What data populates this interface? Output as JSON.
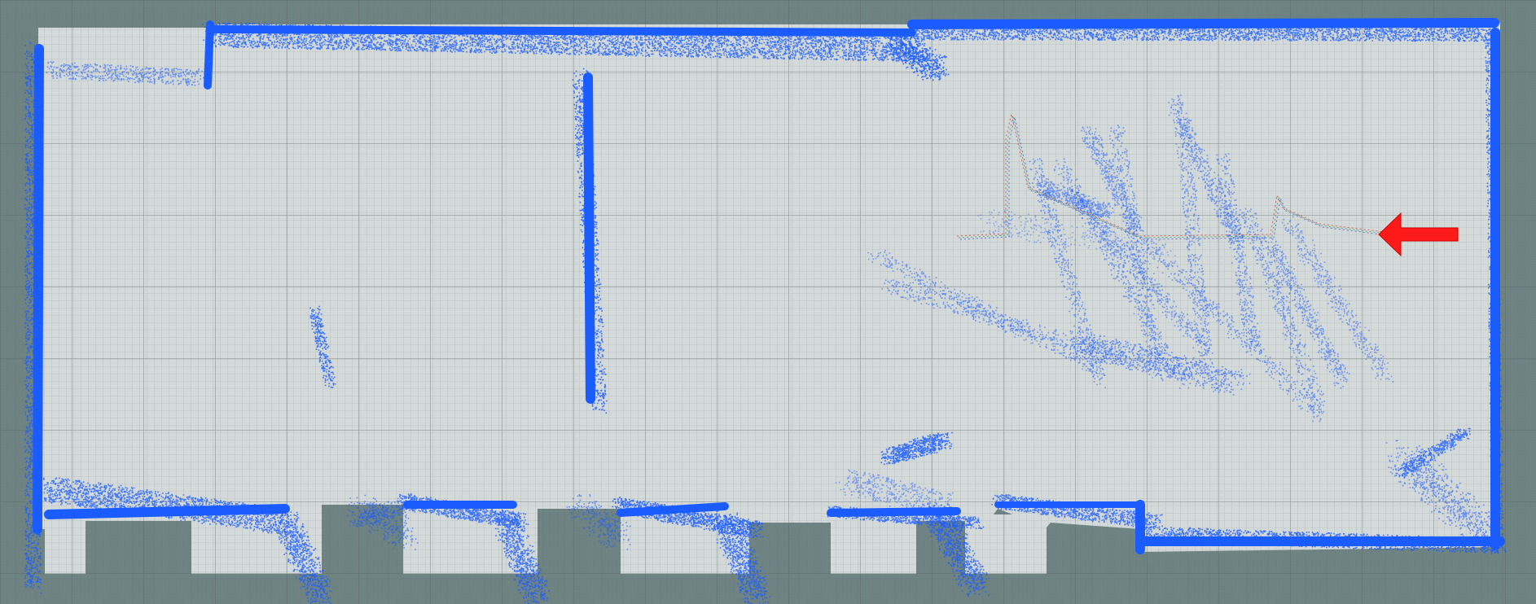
{
  "view": {
    "type": "occupancy-grid-map",
    "background_color": "#6f8482",
    "grid_color": "#5b6b6a",
    "map_free_color": "#d4d9d9",
    "map_grid_color": "#9aa3a3",
    "laser_scan_color": "#1a5cff",
    "pose_arrow_color": "#ff1a1a",
    "planned_path_colors": [
      "#d94040",
      "#3ea04a",
      "#3b5bd9"
    ],
    "grid": true
  },
  "robot": {
    "heading": "left",
    "icon": "pose-arrow-icon"
  }
}
